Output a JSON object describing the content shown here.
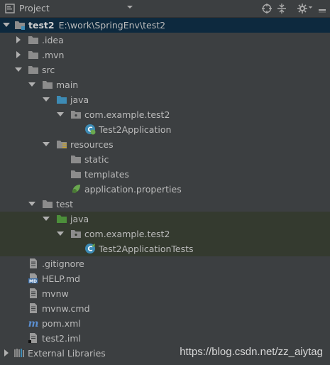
{
  "toolbar": {
    "title": "Project",
    "icons": [
      "project-icon",
      "dropdown-icon",
      "locate-icon",
      "collapse-icon",
      "settings-icon",
      "hide-icon"
    ]
  },
  "tree": {
    "root_name": "test2",
    "root_path": "E:\\work\\SpringEnv\\test2",
    "idea": ".idea",
    "mvn": ".mvn",
    "src": "src",
    "main": "main",
    "main_java": "java",
    "main_pkg": "com.example.test2",
    "app_class": "Test2Application",
    "resources": "resources",
    "static": "static",
    "templates": "templates",
    "app_props": "application.properties",
    "test": "test",
    "test_java": "java",
    "test_pkg": "com.example.test2",
    "test_class": "Test2ApplicationTests",
    "gitignore": ".gitignore",
    "help": "HELP.md",
    "mvnw": "mvnw",
    "mvnw_cmd": "mvnw.cmd",
    "pom": "pom.xml",
    "iml": "test2.iml",
    "ext_libs": "External Libraries"
  },
  "watermark": "https://blog.csdn.net/zz_aiytag",
  "colors": {
    "background": "#3c3f41",
    "selection": "#0d293e",
    "test_band": "#343a2f",
    "folder_gray": "#8c8c8c",
    "folder_blue": "#3d8bb5",
    "folder_green": "#4c8f3a"
  }
}
